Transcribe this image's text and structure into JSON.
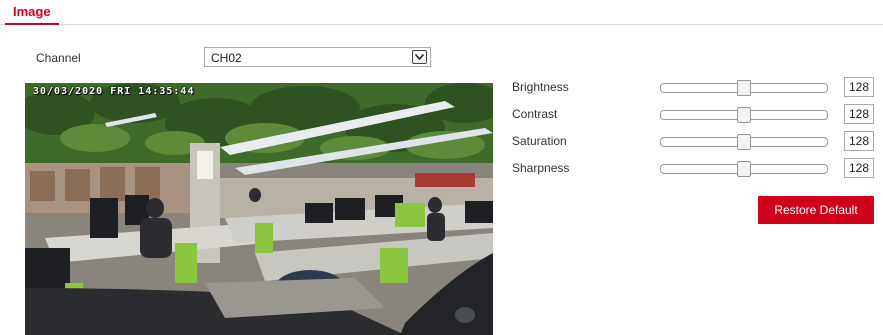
{
  "tabs": [
    {
      "label": "Image",
      "active": true
    }
  ],
  "channel": {
    "label": "Channel",
    "selected": "CH02"
  },
  "video": {
    "osd_text": "30/03/2020 FRI 14:35:44"
  },
  "params": [
    {
      "label": "Brightness",
      "value": "128",
      "fraction": 0.5
    },
    {
      "label": "Contrast",
      "value": "128",
      "fraction": 0.5
    },
    {
      "label": "Saturation",
      "value": "128",
      "fraction": 0.5
    },
    {
      "label": "Sharpness",
      "value": "128",
      "fraction": 0.5
    }
  ],
  "restore_label": "Restore Default",
  "colors": {
    "accent": "#d0021b",
    "foliage": "#3f6b2a",
    "ceiling_light": "#e8ecef",
    "chair_green": "#8cc63f"
  }
}
